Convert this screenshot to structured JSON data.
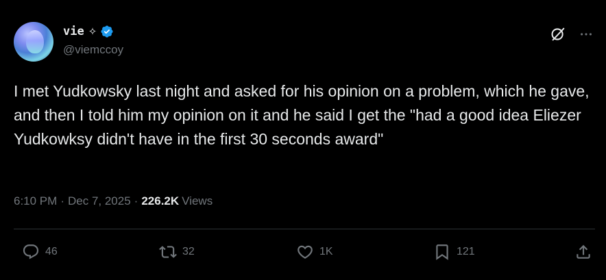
{
  "author": {
    "display_name": "vie",
    "badge_glyph": "✧",
    "handle": "@viemccoy",
    "verified_color": "#1d9bf0"
  },
  "tweet": {
    "text": "I met Yudkowsky last night and asked for his opinion on a problem, which he gave, and then I told him my opinion on it and he said I get the \"had a good idea Eliezer Yudkowksy didn't have in the first 30 seconds award\""
  },
  "meta": {
    "time": "6:10 PM",
    "separator": "·",
    "date": "Dec 7, 2025",
    "views_count": "226.2K",
    "views_label": "Views"
  },
  "actions": {
    "replies": "46",
    "reposts": "32",
    "likes": "1K",
    "bookmarks": "121"
  },
  "colors": {
    "background": "#000000",
    "text_primary": "#e7e9ea",
    "text_secondary": "#71767b",
    "divider": "#2f3336"
  },
  "icons": {
    "top_right": [
      "grok-icon",
      "more-icon"
    ],
    "action_bar": [
      "reply-icon",
      "repost-icon",
      "like-icon",
      "bookmark-icon",
      "share-icon"
    ]
  }
}
